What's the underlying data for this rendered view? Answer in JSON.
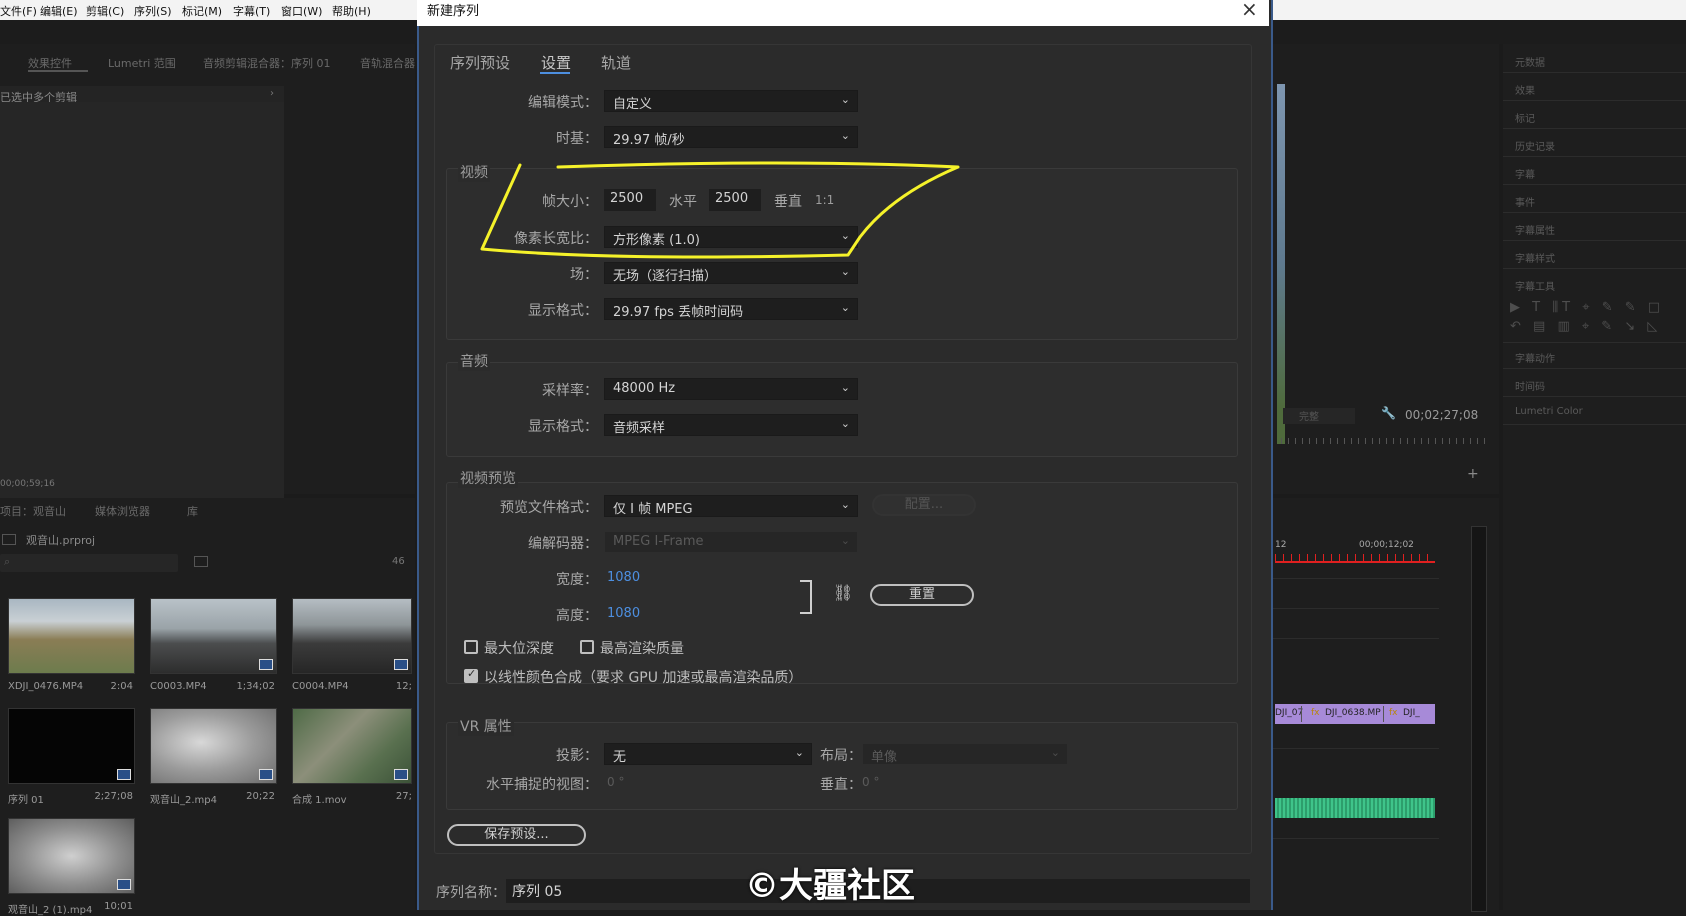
{
  "menubar": {
    "items": [
      "文件(F)",
      "编辑(E)",
      "剪辑(C)",
      "序列(S)",
      "标记(M)",
      "字幕(T)",
      "窗口(W)",
      "帮助(H)"
    ]
  },
  "left_panel": {
    "tabs": [
      "效果控件",
      "Lumetri 范围",
      "音频剪辑混合器：序列 01",
      "音轨混合器"
    ],
    "message": "已选中多个剪辑",
    "timecode": "00;00;59;16"
  },
  "project_panel": {
    "tabs": [
      "项目：观音山",
      "媒体浏览器",
      "库"
    ],
    "project_file": "观音山.prproj",
    "item_count": "46",
    "clips": [
      {
        "name": "XDJI_0476.MP4",
        "duration": "2:04"
      },
      {
        "name": "C0003.MP4",
        "duration": "1;34;02"
      },
      {
        "name": "C0004.MP4",
        "duration": "12;"
      },
      {
        "name": "序列 01",
        "duration": "2;27;08"
      },
      {
        "name": "观音山_2.mp4",
        "duration": "20;22"
      },
      {
        "name": "合成 1.mov",
        "duration": "27;"
      },
      {
        "name": "观音山_2 (1).mp4",
        "duration": "10;01"
      }
    ]
  },
  "program_monitor": {
    "fit": "完整",
    "timecode": "00;02;27;08"
  },
  "timeline": {
    "ruler_start": "00;00;12;02",
    "ruler_label_left": "12",
    "clips": [
      "DJI_07",
      "DJI_0638.MP",
      "DJI_"
    ]
  },
  "right_panel": {
    "items": [
      "元数据",
      "效果",
      "标记",
      "历史记录",
      "字幕",
      "事件",
      "字幕属性",
      "字幕样式",
      "字幕工具",
      "字幕动作",
      "时间码",
      "Lumetri Color"
    ]
  },
  "dialog": {
    "title": "新建序列",
    "close_glyph": "×",
    "tabs": [
      "序列预设",
      "设置",
      "轨道"
    ],
    "edit_mode_label": "编辑模式：",
    "edit_mode_value": "自定义",
    "timebase_label": "时基：",
    "timebase_value": "29.97  帧/秒",
    "video_group": "视频",
    "frame_size_label": "帧大小：",
    "frame_width": "2500",
    "horizontal_label": "水平",
    "frame_height": "2500",
    "vertical_label": "垂直",
    "aspect_ratio": "1:1",
    "pixel_aspect_label": "像素长宽比：",
    "pixel_aspect_value": "方形像素 (1.0)",
    "field_label": "场：",
    "field_value": "无场（逐行扫描）",
    "video_display_label": "显示格式：",
    "video_display_value": "29.97 fps 丢帧时间码",
    "audio_group": "音频",
    "sample_rate_label": "采样率：",
    "sample_rate_value": "48000 Hz",
    "audio_display_label": "显示格式：",
    "audio_display_value": "音频采样",
    "preview_group": "视频预览",
    "preview_format_label": "预览文件格式：",
    "preview_format_value": "仅 I 帧 MPEG",
    "configure_button": "配置...",
    "codec_label": "编解码器：",
    "codec_value": "MPEG I-Frame",
    "width_label": "宽度：",
    "width_value": "1080",
    "height_label": "高度：",
    "height_value": "1080",
    "reset_button": "重置",
    "max_bit_depth": "最大位深度",
    "max_render_quality": "最高渲染质量",
    "linear_color": "以线性颜色合成（要求 GPU 加速或最高渲染品质）",
    "vr_group": "VR 属性",
    "projection_label": "投影：",
    "projection_value": "无",
    "layout_label": "布局：",
    "layout_value": "单像",
    "h_capture_label": "水平捕捉的视图：",
    "h_capture_value": "0 °",
    "v_label": "垂直：",
    "v_value": "0 °",
    "save_preset_button": "保存预设...",
    "seq_name_label": "序列名称：",
    "seq_name_value": "序列 05"
  },
  "watermark": "©大疆社区",
  "colors": {
    "highlight_annotation": "#f5f22a",
    "accent_blue": "#4d8fe0",
    "clip_purple": "#a78ad8",
    "audio_green": "#3fc48a",
    "playhead_red": "#e02020"
  }
}
